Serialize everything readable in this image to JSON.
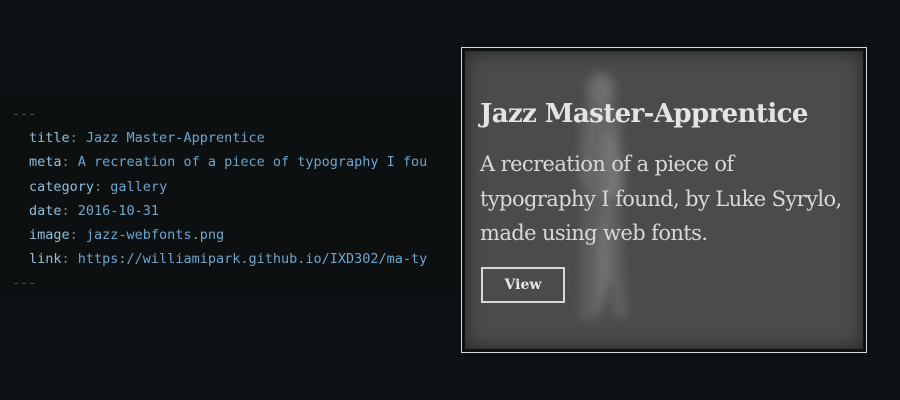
{
  "frontmatter": {
    "delimiter": "---",
    "fields": [
      {
        "key": "title",
        "value": "Jazz Master-Apprentice"
      },
      {
        "key": "meta",
        "value": "A recreation of a piece of typography I fou"
      },
      {
        "key": "category",
        "value": "gallery"
      },
      {
        "key": "date",
        "value": "2016-10-31"
      },
      {
        "key": "image",
        "value": "jazz-webfonts.png"
      },
      {
        "key": "link",
        "value": "https://williamipark.github.io/IXD302/ma-ty"
      }
    ]
  },
  "card": {
    "title": "Jazz Master-Apprentice",
    "description": "A recreation of a piece of typography I found, by Luke Syrylo, made using web fonts.",
    "button_label": "View",
    "background_image": "blurred-saxophone-player-silhouette"
  },
  "colors": {
    "page_background": "#0e1113",
    "code_key": "#8fbfdc",
    "code_value": "#6ba6cf",
    "card_background": "#4a4b4d",
    "card_border": "#d9d9d9"
  }
}
